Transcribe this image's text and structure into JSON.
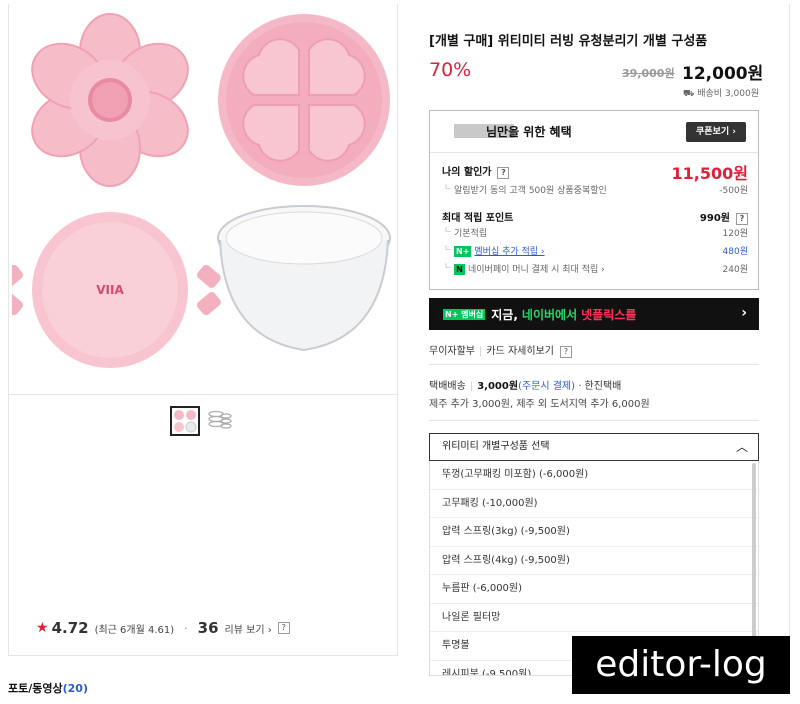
{
  "product": {
    "title": "[개별 구매] 위티미티 러빙 유청분리기 개별 구성품",
    "discount": "70%",
    "original_price": "39,000원",
    "price": "12,000원",
    "shipping": "배송비 3,000원",
    "thumbnails": [
      "thumb-main",
      "thumb-2"
    ]
  },
  "benefit": {
    "title": "님만을 위한 혜택",
    "coupon_button": "쿠폰보기 ›",
    "my_discount_label": "나의 할인가",
    "my_discount_value": "11,500원",
    "alarm_label": "알림받기 동의 고객 500원 상품중복할인",
    "alarm_value": "-500원",
    "points_label": "최대 적립 포인트",
    "points_value": "990원",
    "basic_label": "기본적립",
    "basic_value": "120원",
    "membership_badge": "N+",
    "membership_label": "멤버십 추가 적립 ›",
    "membership_value": "480원",
    "npay_badge": "N",
    "npay_label": "네이버페이 머니 결제 시 최대 적립 ›",
    "npay_value": "240원"
  },
  "banner": {
    "badge": "N+ 멤버십",
    "text1": "지금,",
    "text2": "네이버에서",
    "text3": "넷플릭스를",
    "arrow": "›"
  },
  "installment": {
    "label": "무이자할부",
    "link": "카드 자세히보기"
  },
  "delivery": {
    "type": "택배배송",
    "fee": "3,000원",
    "fee_note": "(주문시 결제)",
    "carrier": "· 한진택배",
    "extra": "제주 추가 3,000원, 제주 외 도서지역 추가 6,000원"
  },
  "option": {
    "selected": "위티미티 개별구성품 선택",
    "items": [
      "뚜껑(고무패킹 미포함) (-6,000원)",
      "고무패킹 (-10,000원)",
      "압력 스프링(3kg) (-9,500원)",
      "압력 스프링(4kg) (-9,500원)",
      "누름판 (-6,000원)",
      "나일론 필터망",
      "투명볼",
      "레시피북 (-9,500원)"
    ]
  },
  "rating": {
    "score": "4.72",
    "recent": "(최근 6개월 4.61)",
    "reviews": "36",
    "review_link": "리뷰 보기 ›"
  },
  "photo_tab": {
    "label": "포토/동영상",
    "count": "(20)"
  },
  "watermark": "editor-log",
  "colors": {
    "accent_red": "#e0203a",
    "naver_green": "#03c75a",
    "pink": "#f4b6c2"
  }
}
